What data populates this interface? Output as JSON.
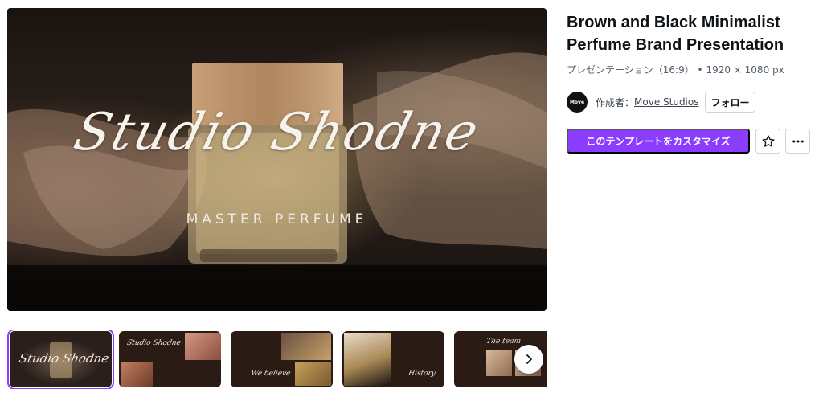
{
  "preview": {
    "script_title": "Studio Shodne",
    "subtitle": "MASTER PERFUME"
  },
  "thumbnails": [
    {
      "script": "Studio Shodne",
      "selected": true
    },
    {
      "script": "Studio Shodne",
      "selected": false
    },
    {
      "script": "We believe",
      "selected": false
    },
    {
      "script": "History",
      "selected": false
    },
    {
      "script": "The team",
      "selected": false
    }
  ],
  "template": {
    "title": "Brown and Black Minimalist Perfume Brand Presentation",
    "type": "プレゼンテーション（16:9）",
    "dimensions": "• 1920 × 1080 px"
  },
  "creator": {
    "avatar_text": "Move",
    "prefix": "作成者：",
    "name": "Move Studios",
    "follow_label": "フォロー"
  },
  "actions": {
    "customize_label": "このテンプレートをカスタマイズ",
    "favorite_icon": "star-icon",
    "more_icon": "more-horizontal-icon"
  },
  "colors": {
    "accent": "#8b3dff",
    "title": "#0e1318",
    "muted": "#555f6d"
  }
}
